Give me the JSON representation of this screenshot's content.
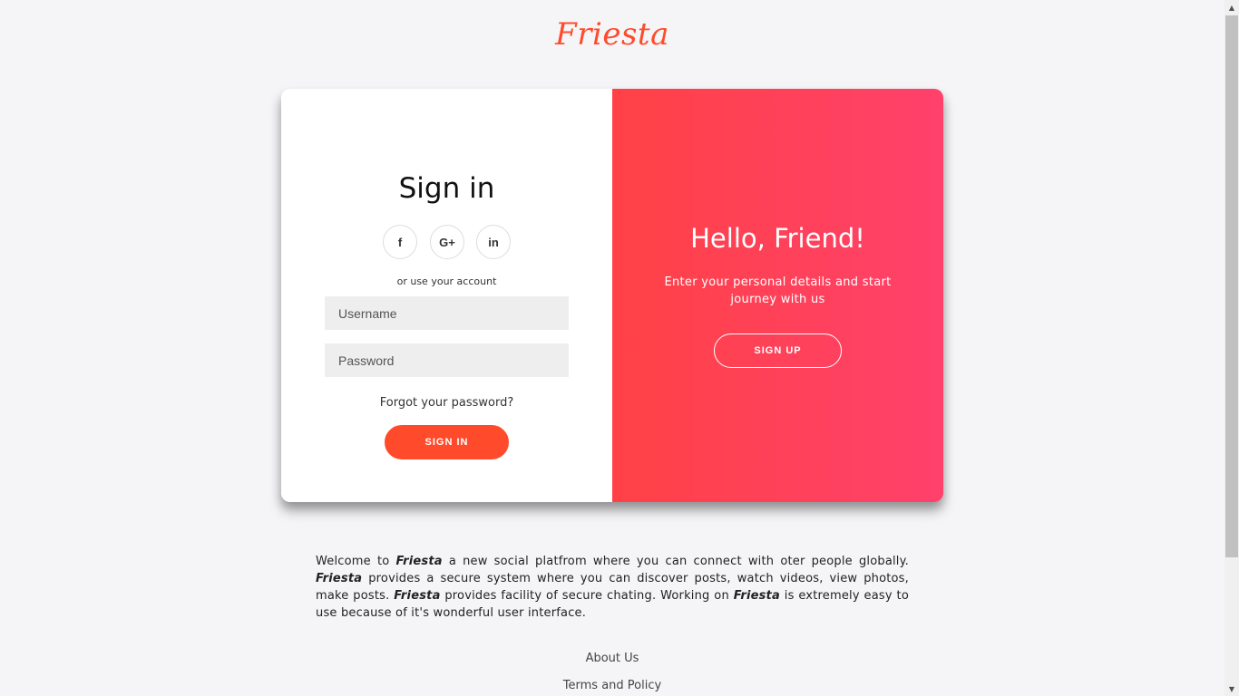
{
  "brand": {
    "logo": "Friesta",
    "accent_color": "#ff4b2b",
    "gradient_start": "#ff4146",
    "gradient_end": "#ff416c"
  },
  "signin": {
    "title": "Sign in",
    "social": [
      {
        "icon": "facebook-icon",
        "glyph": "f"
      },
      {
        "icon": "google-plus-icon",
        "glyph": "G+"
      },
      {
        "icon": "linkedin-icon",
        "glyph": "in"
      }
    ],
    "alt_text": "or use your account",
    "username_placeholder": "Username",
    "username_value": "",
    "password_placeholder": "Password",
    "password_value": "",
    "forgot": "Forgot your password?",
    "button": "SIGN IN"
  },
  "signup_panel": {
    "title": "Hello, Friend!",
    "text": "Enter your personal details and start journey with us",
    "button": "SIGN UP"
  },
  "about": {
    "segments": [
      {
        "text": "Welcome to ",
        "em": false
      },
      {
        "text": "Friesta",
        "em": true
      },
      {
        "text": " a new social platfrom where you can connect with oter people globally. ",
        "em": false
      },
      {
        "text": "Friesta",
        "em": true
      },
      {
        "text": " provides a secure system where you can discover posts, watch videos, view photos, make posts. ",
        "em": false
      },
      {
        "text": "Friesta",
        "em": true
      },
      {
        "text": " provides facility of secure chating. Working on ",
        "em": false
      },
      {
        "text": "Friesta",
        "em": true
      },
      {
        "text": " is extremely easy to use because of it's wonderful user interface.",
        "em": false
      }
    ]
  },
  "footer": {
    "links": [
      "About Us",
      "Terms and Policy"
    ]
  }
}
